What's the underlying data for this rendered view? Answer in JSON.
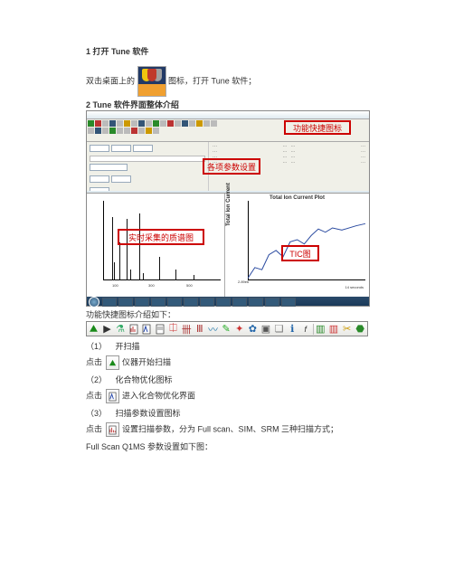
{
  "doc": {
    "section1_title": "1 打开 Tune 软件",
    "desktop_prefix": "双击桌面上的",
    "desktop_suffix": "图标，打开 Tune 软件；",
    "section2_title": "2 Tune 软件界面整体介绍",
    "toolbar_intro": "功能快捷图标介绍如下：",
    "items": [
      {
        "num": "（1）",
        "label": "开扫描"
      },
      {
        "num": "（2）",
        "label": "化合物优化图标"
      },
      {
        "num": "（3）",
        "label": "扫描参数设置图标"
      }
    ],
    "click_lines": [
      {
        "prefix": "点击",
        "suffix": "仪器开始扫描",
        "icon": "play-green-icon"
      },
      {
        "prefix": "点击",
        "suffix": "进入化合物优化界面",
        "icon": "optimize-icon"
      },
      {
        "prefix": "点击",
        "suffix": "设置扫描参数，分为 Full scan、SIM、SRM 三种扫描方式；",
        "icon": "scan-define-icon"
      }
    ],
    "fullscan_line": "Full Scan Q1MS 参数设置如下图："
  },
  "screenshot_annotations": {
    "toolbar_box_label": "功能快捷图标",
    "params_box_label": "各项参数设置",
    "spectrum_box_label": "实时采集的质谱图",
    "tic_box_label": "TIC图"
  },
  "tic_plot": {
    "title": "Total Ion Current Plot",
    "ylabel": "Total Ion Current",
    "y_tick": "2.89e6",
    "x_end_label": "14 seconds"
  },
  "chart_data": {
    "type": "line",
    "title": "Total Ion Current Plot",
    "xlabel": "seconds",
    "ylabel": "Total Ion Current",
    "x": [
      0,
      1,
      2,
      3,
      4,
      5,
      6,
      7,
      8,
      9,
      10,
      11,
      12,
      13,
      14
    ],
    "values": [
      2900000.0,
      3600000.0,
      3400000.0,
      4800000.0,
      5200000.0,
      4700000.0,
      6400000.0,
      6600000.0,
      6100000.0,
      7200000.0,
      7900000.0,
      7500000.0,
      8000000.0,
      7800000.0,
      8200000.0
    ],
    "ylim": [
      2890000.0,
      9000000.0
    ],
    "xlim": [
      0,
      14
    ]
  },
  "toolbar_icons": [
    "play-icon",
    "record-icon",
    "flask-icon",
    "scan-setup-icon",
    "optimize-icon",
    "tune-page-icon",
    "calibrate-icon",
    "peak-labels-icon",
    "spectrum-icon",
    "chromatogram-icon",
    "pencil-icon",
    "brush-icon",
    "gear-icon",
    "camera-icon",
    "report-icon",
    "annotate-icon",
    "fx-icon",
    "divider",
    "browser-icon",
    "compound-icon",
    "syringe-icon",
    "object-icon"
  ]
}
